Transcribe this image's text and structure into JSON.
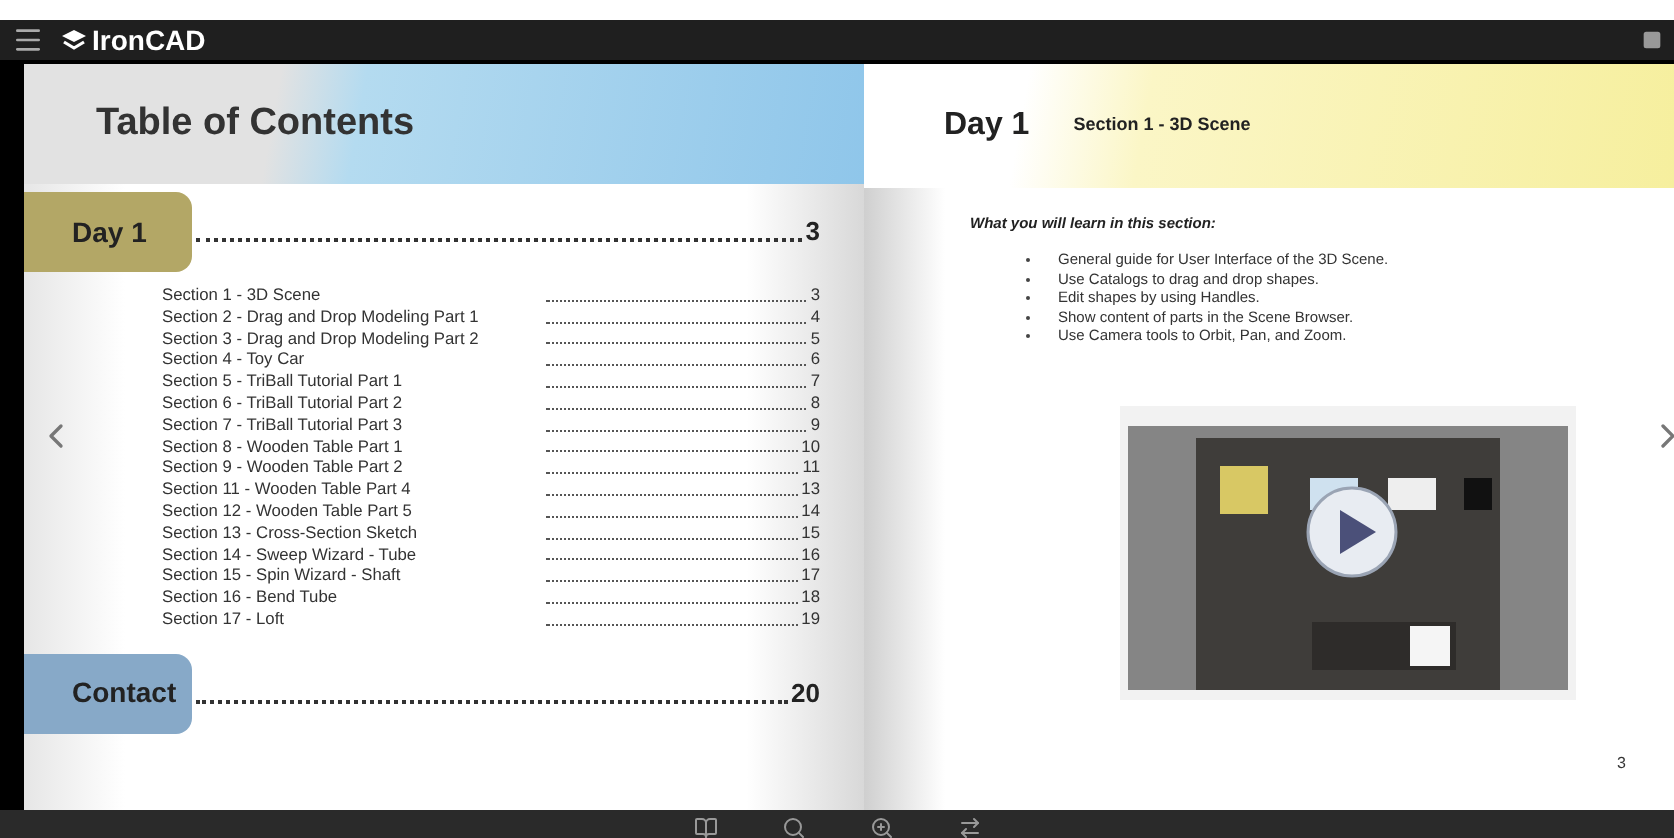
{
  "app": {
    "brand": "IronCAD"
  },
  "left_page": {
    "title": "Table of Contents",
    "chapters": [
      {
        "label": "Day 1",
        "page": "3",
        "color": "#b3a766",
        "sections": [
          {
            "label": "Section 1 - 3D Scene",
            "page": "3"
          },
          {
            "label": "Section 2 - Drag and Drop Modeling Part 1",
            "page": "4"
          },
          {
            "label": "Section 3 - Drag and Drop Modeling Part 2",
            "page": "5"
          },
          {
            "label": "Section 4 - Toy Car",
            "page": "6"
          },
          {
            "label": "Section 5 - TriBall Tutorial Part 1",
            "page": "7"
          },
          {
            "label": "Section 6 - TriBall Tutorial Part 2",
            "page": "8"
          },
          {
            "label": "Section 7 - TriBall Tutorial Part 3",
            "page": "9"
          },
          {
            "label": "Section 8 - Wooden Table Part 1",
            "page": "10"
          },
          {
            "label": "Section 9 - Wooden Table Part 2",
            "page": "11"
          },
          {
            "label": "Section 11 - Wooden Table Part 4",
            "page": "13"
          },
          {
            "label": "Section 12 - Wooden Table Part 5",
            "page": "14"
          },
          {
            "label": "Section 13 - Cross-Section Sketch",
            "page": "15"
          },
          {
            "label": "Section 14 - Sweep Wizard - Tube",
            "page": "16"
          },
          {
            "label": "Section 15 - Spin Wizard - Shaft",
            "page": "17"
          },
          {
            "label": "Section 16 - Bend Tube",
            "page": "18"
          },
          {
            "label": "Section 17 - Loft",
            "page": "19"
          }
        ]
      },
      {
        "label": "Contact",
        "page": "20",
        "color": "#87a9c8"
      }
    ]
  },
  "right_page": {
    "day": "Day 1",
    "section": "Section 1 - 3D Scene",
    "intro": "What you will learn in this section:",
    "bullets": [
      "General guide for User Interface of the 3D Scene.",
      "Use Catalogs to drag and drop shapes.",
      "Edit shapes by using Handles.",
      "Show content of parts in the Scene Browser.",
      "Use Camera tools to Orbit, Pan, and Zoom."
    ],
    "page_number": "3"
  }
}
